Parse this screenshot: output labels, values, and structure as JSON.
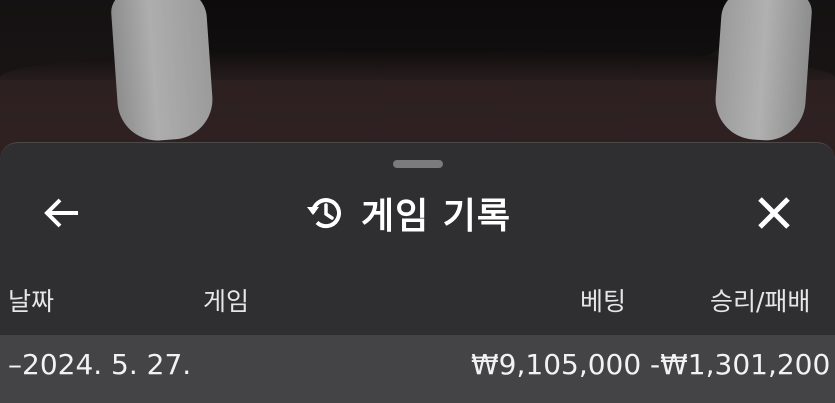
{
  "sheet": {
    "title": "게임 기록",
    "back_icon": "arrow-left-icon",
    "history_icon": "history-icon",
    "close_icon": "close-icon"
  },
  "table": {
    "headers": {
      "date": "날짜",
      "game": "게임",
      "bet": "베팅",
      "result": "승리/패배"
    },
    "rows": [
      {
        "date": "–2024. 5. 27.",
        "game": "",
        "bet": "₩9,105,000",
        "result": "-₩1,301,200"
      }
    ]
  },
  "colors": {
    "sheet_bg": "#2f2f31",
    "row_bg": "#444446",
    "text": "#ffffff"
  }
}
